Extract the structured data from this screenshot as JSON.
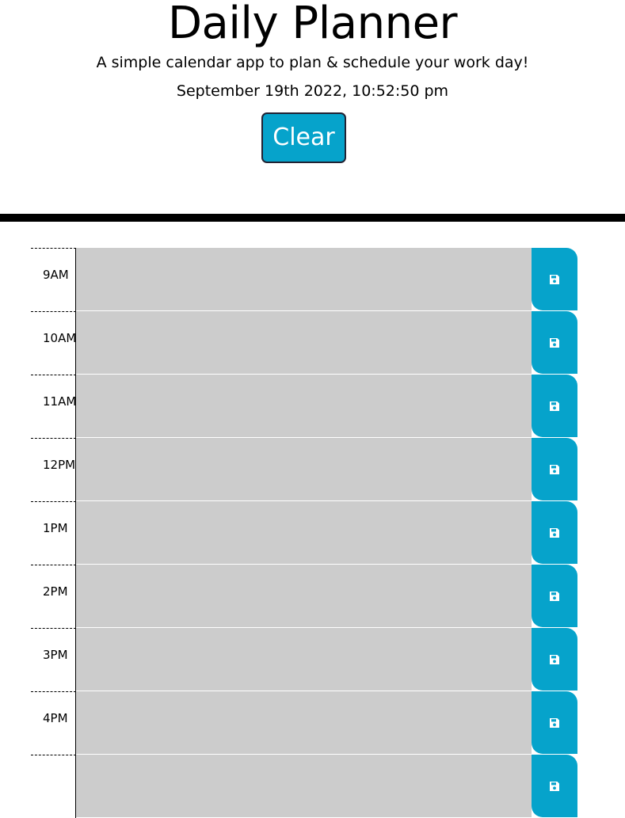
{
  "header": {
    "title": "Daily Planner",
    "subtitle": "A simple calendar app to plan & schedule your work day!",
    "datetime": "September 19th 2022, 10:52:50 pm",
    "clear_label": "Clear"
  },
  "colors": {
    "accent": "#06a3cb",
    "past_row": "#cccccc",
    "divider": "#000000"
  },
  "rows": [
    {
      "hour": "9AM",
      "task": "",
      "save_icon": "floppy-disk-icon"
    },
    {
      "hour": "10AM",
      "task": "",
      "save_icon": "floppy-disk-icon"
    },
    {
      "hour": "11AM",
      "task": "",
      "save_icon": "floppy-disk-icon"
    },
    {
      "hour": "12PM",
      "task": "",
      "save_icon": "floppy-disk-icon"
    },
    {
      "hour": "1PM",
      "task": "",
      "save_icon": "floppy-disk-icon"
    },
    {
      "hour": "2PM",
      "task": "",
      "save_icon": "floppy-disk-icon"
    },
    {
      "hour": "3PM",
      "task": "",
      "save_icon": "floppy-disk-icon"
    },
    {
      "hour": "4PM",
      "task": "",
      "save_icon": "floppy-disk-icon"
    },
    {
      "hour": "",
      "task": "",
      "save_icon": "floppy-disk-icon"
    }
  ]
}
